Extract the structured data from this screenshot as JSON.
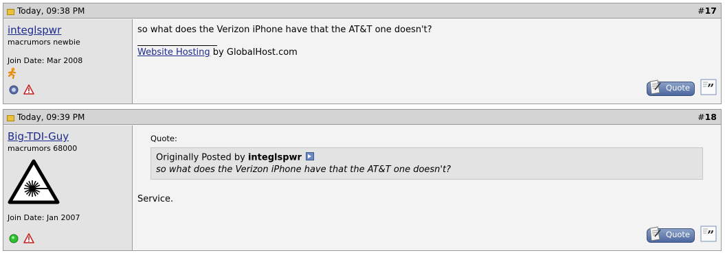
{
  "posts": [
    {
      "date": "Today, 09:38 PM",
      "number_prefix": "#",
      "number": "17",
      "username": "integlspwr",
      "user_title": "macrumors newbie",
      "join_date": "Join Date: Mar 2008",
      "message": "so what does the Verizon iPhone have that the AT&T one doesn't?",
      "signature_link": "Website Hosting",
      "signature_rest": " by GlobalHost.com",
      "quote_button": "Quote",
      "online_status": "offline"
    },
    {
      "date": "Today, 09:39 PM",
      "number_prefix": "#",
      "number": "18",
      "username": "Big-TDI-Guy",
      "user_title": "macrumors 68000",
      "join_date": "Join Date: Jan 2007",
      "quote_label": "Quote:",
      "quote_posted_by": "Originally Posted by ",
      "quote_author": "integlspwr",
      "quote_text": "so what does the Verizon iPhone have that the AT&T one doesn't?",
      "message": "Service.",
      "quote_button": "Quote",
      "online_status": "online"
    }
  ],
  "colors": {
    "header_bg": "#d4d4d4",
    "userinfo_bg": "#e3e3e3",
    "message_bg": "#f3f3f3",
    "link": "#1b2a8c",
    "online": "#2fbf2f",
    "offline": "#5a6fa8"
  }
}
